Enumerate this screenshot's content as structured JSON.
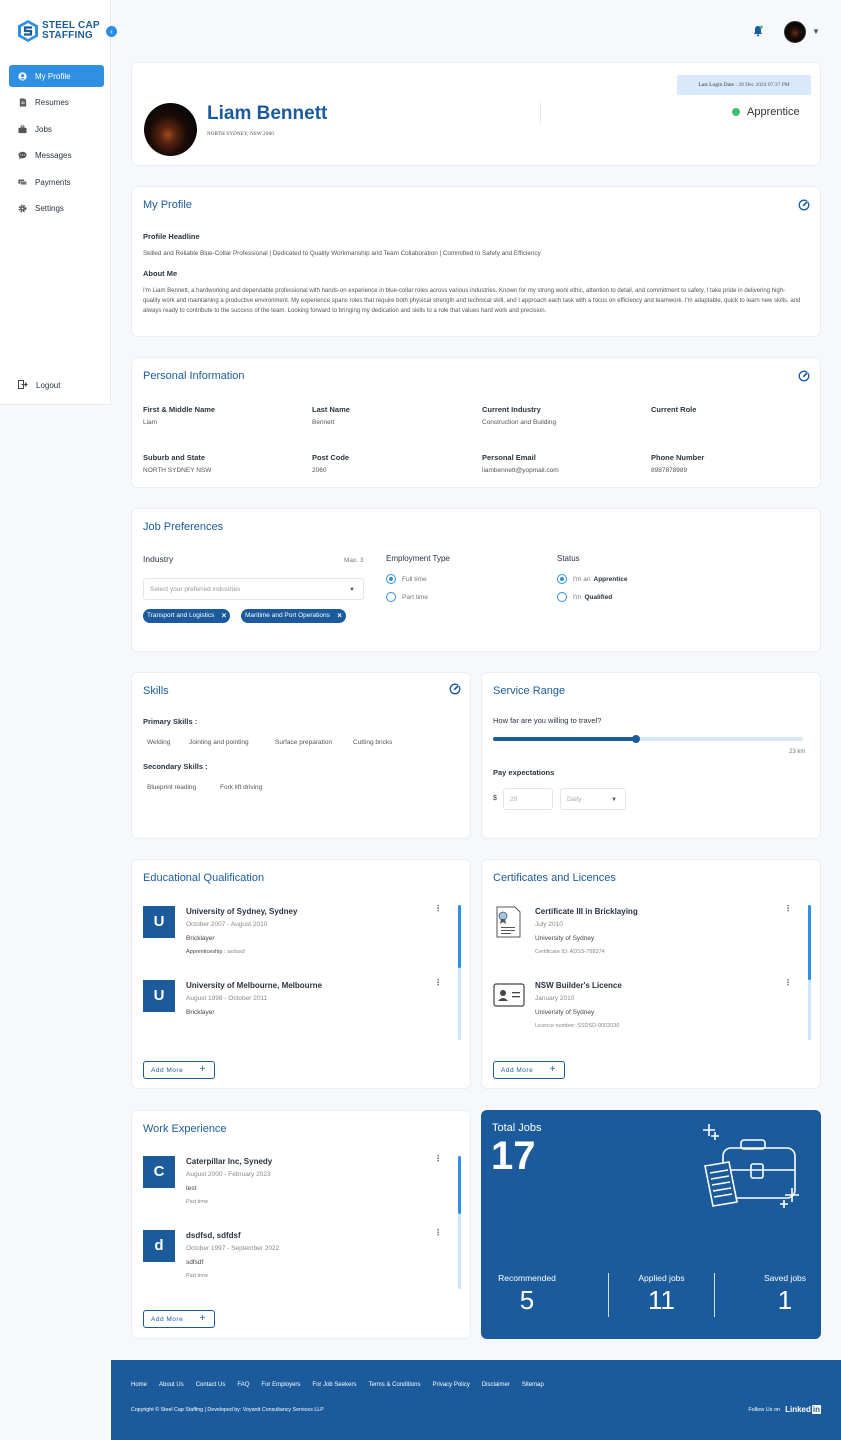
{
  "brand": {
    "line1": "STEEL CAP",
    "line2": "STAFFING"
  },
  "sidebar": {
    "items": [
      {
        "label": "My Profile",
        "icon": "user-circle-icon",
        "active": true
      },
      {
        "label": "Resumes",
        "icon": "document-icon",
        "active": false
      },
      {
        "label": "Jobs",
        "icon": "briefcase-icon",
        "active": false
      },
      {
        "label": "Messages",
        "icon": "chat-icon",
        "active": false
      },
      {
        "label": "Payments",
        "icon": "money-icon",
        "active": false
      },
      {
        "label": "Settings",
        "icon": "gear-icon",
        "active": false
      }
    ],
    "logout": "Logout"
  },
  "profile": {
    "name": "Liam Bennett",
    "location": "NORTH SYDNEY, NSW 2060",
    "last_login_label": "Last Login Date :",
    "last_login_value": "28 Dec 2024 07:37 PM",
    "status": "Apprentice"
  },
  "my_profile": {
    "title": "My Profile",
    "headline_label": "Profile Headline",
    "headline": "Skilled and Reliable Blue-Collar Professional | Dedicated to Quality Workmanship and Team Collaboration | Committed to Safety and Efficiency",
    "about_label": "About Me",
    "about": "I'm Liam Bennett, a hardworking and dependable professional with hands-on experience in blue-collar roles across various industries. Known for my strong work ethic, attention to detail, and commitment to safety, I take pride in delivering high-quality work and maintaining a productive environment. My experience spans roles that require both physical strength and technical skill, and I approach each task with a focus on efficiency and teamwork. I'm adaptable, quick to learn new skills, and always ready to contribute to the success of the team. Looking forward to bringing my dedication and skills to a role that values hard work and precision."
  },
  "personal": {
    "title": "Personal Information",
    "fields": [
      {
        "label": "First & Middle Name",
        "value": "Liam"
      },
      {
        "label": "Last Name",
        "value": "Bennett"
      },
      {
        "label": "Current Industry",
        "value": "Construction and Building"
      },
      {
        "label": "Current Role",
        "value": ""
      },
      {
        "label": "Suburb and State",
        "value": "NORTH SYDNEY NSW"
      },
      {
        "label": "Post Code",
        "value": "2060"
      },
      {
        "label": "Personal Email",
        "value": "liambennett@yopmail.com"
      },
      {
        "label": "Phone Number",
        "value": "8987878989"
      }
    ]
  },
  "job_prefs": {
    "title": "Job Preferences",
    "industry_label": "Industry",
    "industry_max": "Max. 3",
    "industry_placeholder": "Select your preferred industries",
    "industries": [
      "Transport and Logistics",
      "Maritime and Port Operations"
    ],
    "employment_label": "Employment Type",
    "employment_options": [
      {
        "label": "Full time",
        "selected": true
      },
      {
        "label": "Part time",
        "selected": false
      }
    ],
    "status_label": "Status",
    "status_prefix": "I'm",
    "status_options": [
      {
        "label": "an",
        "bold": "Apprentice",
        "selected": true
      },
      {
        "label": "",
        "bold": "Qualified",
        "selected": false
      }
    ]
  },
  "skills": {
    "title": "Skills",
    "primary_label": "Primary Skills :",
    "primary": [
      "Welding",
      "Jointing and pointing",
      "Surface preparation",
      "Cutting bricks"
    ],
    "secondary_label": "Secondary Skills :",
    "secondary": [
      "Blueprint reading",
      "Fork lift driving"
    ]
  },
  "service_range": {
    "title": "Service Range",
    "travel_label": "How far are you willing to travel?",
    "travel_value": "23 km",
    "travel_fraction": 0.46,
    "pay_label": "Pay expectations",
    "currency": "$",
    "pay_value": "20",
    "pay_period": "Daily"
  },
  "education": {
    "title": "Educational Qualification",
    "items": [
      {
        "initial": "U",
        "title": "University of Sydney, Sydney",
        "dates": "October 2007 - August 2010",
        "line": "Bricklayer",
        "extra_label": "Apprenticeship :",
        "extra_value": "asdasd"
      },
      {
        "initial": "U",
        "title": "University of Melbourne, Melbourne",
        "dates": "August 1998 - October 2011",
        "line": "Bricklayer",
        "extra_label": "",
        "extra_value": ""
      }
    ],
    "add_label": "Add More"
  },
  "certificates": {
    "title": "Certificates and Licences",
    "items": [
      {
        "icon": "certificate-icon",
        "title": "Certificate III in Bricklaying",
        "date": "July 2010",
        "issuer": "University of Sydney",
        "id_line": "Certificate ID: ADSS-798374"
      },
      {
        "icon": "id-card-icon",
        "title": "NSW Builder's Licence",
        "date": "January 2010",
        "issuer": "University of Sydney",
        "id_line": "Licence number: SSDSD-0002030"
      }
    ],
    "add_label": "Add More"
  },
  "work": {
    "title": "Work Experience",
    "items": [
      {
        "initial": "C",
        "title": "Caterpillar Inc, Synedy",
        "dates": "August 2000 - February 2023",
        "line": "test",
        "type": "Part time"
      },
      {
        "initial": "d",
        "title": "dsdfsd, sdfdsf",
        "dates": "October 1997 - September 2022",
        "line": "sdfsdf",
        "type": "Part time"
      }
    ],
    "add_label": "Add More"
  },
  "jobs": {
    "title": "Total Jobs",
    "total": "17",
    "recommended_label": "Recommended",
    "recommended": "5",
    "applied_label": "Applied jobs",
    "applied": "11",
    "saved_label": "Saved jobs",
    "saved": "1"
  },
  "footer": {
    "links": [
      "Home",
      "About Us",
      "Contact Us",
      "FAQ",
      "For Employers",
      "For Job Seekers",
      "Terms & Conditions",
      "Privacy Policy",
      "Disclaimer",
      "Sitemap"
    ],
    "copyright": "Copyright © Steel Cap Staffing | Developed by: Voyantt Consultancy Services LLP",
    "follow": "Follow Us on",
    "linkedin_a": "Linked",
    "linkedin_b": "in"
  },
  "colors": {
    "primary": "#1b5b9c",
    "accent": "#2f8fe2",
    "status": "#3cc468"
  }
}
